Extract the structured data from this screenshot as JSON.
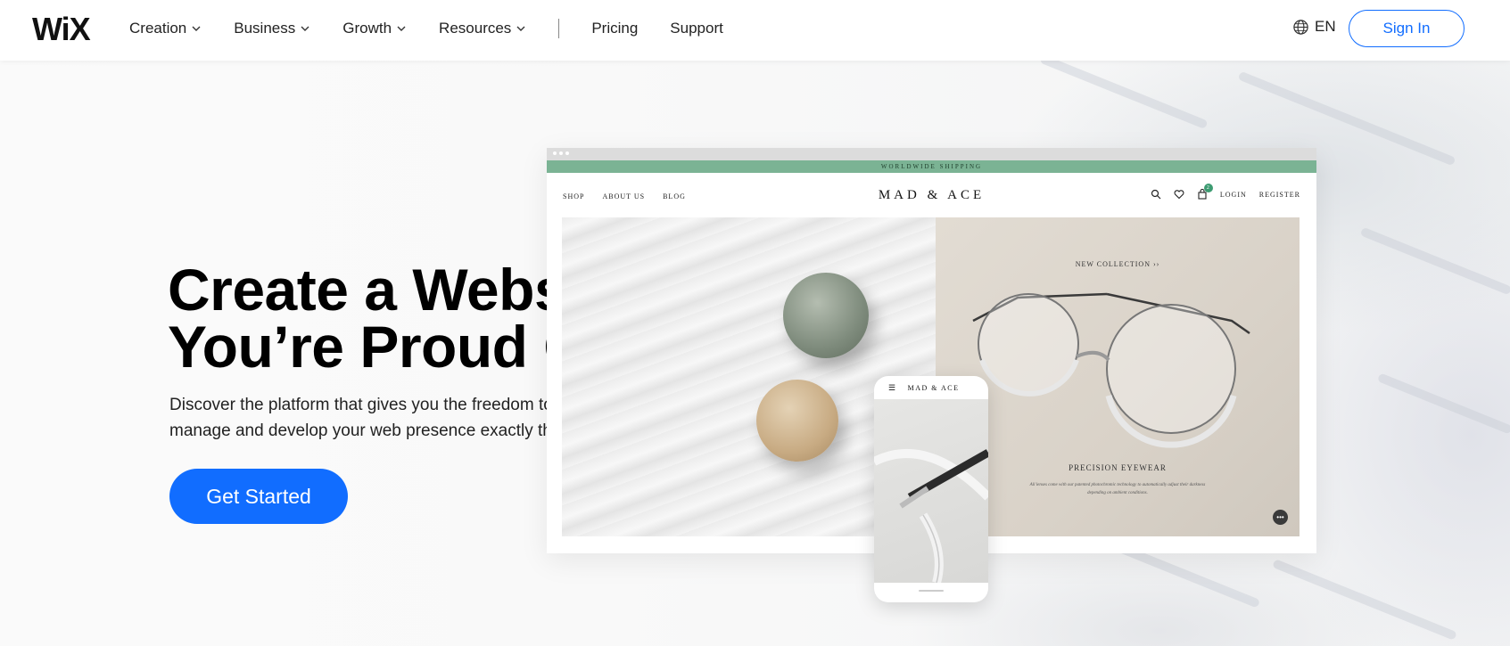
{
  "header": {
    "logo": "WiX",
    "nav": [
      {
        "label": "Creation",
        "dropdown": true
      },
      {
        "label": "Business",
        "dropdown": true
      },
      {
        "label": "Growth",
        "dropdown": true
      },
      {
        "label": "Resources",
        "dropdown": true
      }
    ],
    "nav_links": [
      "Pricing",
      "Support"
    ],
    "language": "EN",
    "sign_in": "Sign In"
  },
  "hero": {
    "headline_line1": "Create a Website",
    "headline_line2": "You’re Proud Of",
    "subtext": "Discover the platform that gives you the freedom to create, design, manage and develop your web presence exactly the way you want.",
    "cta": "Get Started"
  },
  "mockup": {
    "banner": "WORLDWIDE SHIPPING",
    "brand": "MAD & ACE",
    "nav_left": [
      "SHOP",
      "ABOUT US",
      "BLOG"
    ],
    "nav_right": [
      "LOGIN",
      "REGISTER"
    ],
    "cart_count": "2",
    "new_collection": "NEW COLLECTION  ››",
    "product_title": "PRECISION EYEWEAR",
    "product_desc": "All lenses come with our patented photochromic technology to automatically adjust their darkness depending on ambient conditions.",
    "phone_brand": "MAD & ACE"
  },
  "colors": {
    "accent": "#116dff",
    "banner": "#7bb394"
  }
}
